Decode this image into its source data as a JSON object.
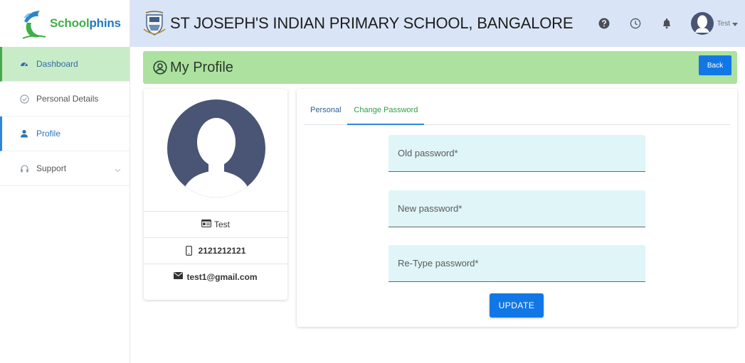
{
  "brand": {
    "name_part1": "School",
    "name_part2": "phins",
    "color_green": "#3fae49",
    "color_blue": "#1f78c6"
  },
  "header": {
    "school_name": "ST JOSEPH'S INDIAN PRIMARY SCHOOL, BANGALORE",
    "icons": [
      "help-icon",
      "clock-icon",
      "bell-icon"
    ],
    "user_name": "Test"
  },
  "sidebar": {
    "items": [
      {
        "label": "Dashboard",
        "icon": "dashboard-icon"
      },
      {
        "label": "Personal Details",
        "icon": "check-circle-icon"
      },
      {
        "label": "Profile",
        "icon": "user-icon"
      },
      {
        "label": "Support",
        "icon": "headset-icon"
      }
    ]
  },
  "title_bar": {
    "title": "My Profile",
    "back_label": "Back",
    "accent": "#ace19f"
  },
  "profile_card": {
    "name": "Test",
    "phone": "2121212121",
    "email": "test1@gmail.com"
  },
  "form": {
    "tabs": [
      {
        "label": "Personal"
      },
      {
        "label": "Change Password"
      }
    ],
    "old_password": {
      "placeholder": "Old password*",
      "value": ""
    },
    "new_password": {
      "placeholder": "New password*",
      "value": ""
    },
    "retype_password": {
      "placeholder": "Re-Type password*",
      "value": ""
    },
    "update_label": "UPDATE",
    "button_color": "#1277e6"
  }
}
